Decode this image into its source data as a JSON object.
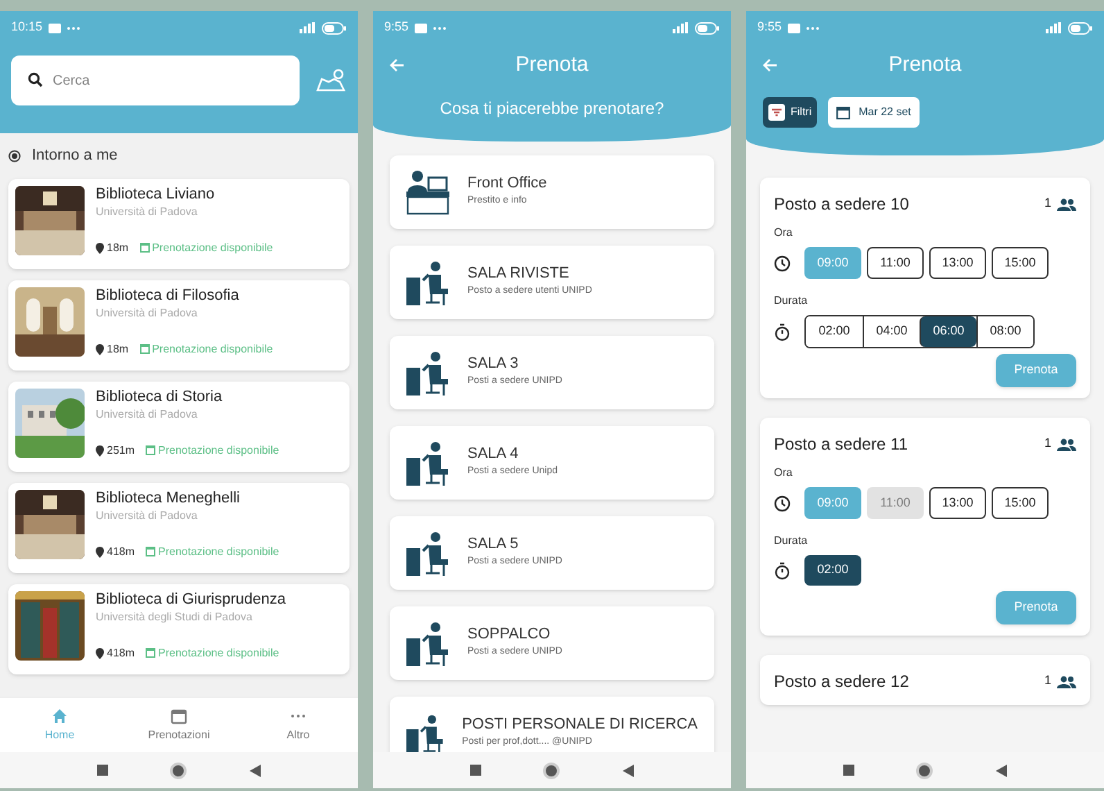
{
  "screens": [
    {
      "kind": "home",
      "status": {
        "time": "10:15"
      },
      "search": {
        "placeholder": "Cerca"
      },
      "section": "Intorno a me",
      "libraries": [
        {
          "name": "Biblioteca Liviano",
          "org": "Università di Padova",
          "distance": "18m",
          "availability": "Prenotazione disponibile"
        },
        {
          "name": "Biblioteca di Filosofia",
          "org": "Università di Padova",
          "distance": "18m",
          "availability": "Prenotazione disponibile"
        },
        {
          "name": "Biblioteca di Storia",
          "org": "Università di Padova",
          "distance": "251m",
          "availability": "Prenotazione disponibile"
        },
        {
          "name": "Biblioteca Meneghelli",
          "org": "Università di Padova",
          "distance": "418m",
          "availability": "Prenotazione disponibile"
        },
        {
          "name": "Biblioteca di Giurisprudenza",
          "org": "Università degli Studi di Padova",
          "distance": "418m",
          "availability": "Prenotazione disponibile"
        }
      ],
      "bottom_nav": [
        {
          "label": "Home",
          "selected": true,
          "kind": "home"
        },
        {
          "label": "Prenotazioni",
          "selected": false,
          "kind": "calendar"
        },
        {
          "label": "Altro",
          "selected": false,
          "kind": "more"
        }
      ]
    },
    {
      "kind": "rooms",
      "status": {
        "time": "9:55"
      },
      "title": "Prenota",
      "subtitle": "Cosa ti piacerebbe prenotare?",
      "rooms": [
        {
          "name": "Front Office",
          "description": "Prestito e info",
          "kind": "desk"
        },
        {
          "name": "SALA RIVISTE",
          "description": "Posto a sedere utenti UNIPD",
          "kind": "seat"
        },
        {
          "name": "SALA 3",
          "description": "Posti a sedere UNIPD",
          "kind": "seat"
        },
        {
          "name": "SALA 4",
          "description": "Posti a sedere Unipd",
          "kind": "seat"
        },
        {
          "name": "SALA 5",
          "description": "Posti a sedere UNIPD",
          "kind": "seat"
        },
        {
          "name": "SOPPALCO",
          "description": "Posti a sedere UNIPD",
          "kind": "seat"
        },
        {
          "name": "POSTI PERSONALE DI RICERCA",
          "description": "Posti per prof,dott.... @UNIPD",
          "kind": "seat"
        }
      ]
    },
    {
      "kind": "seats",
      "status": {
        "time": "9:55"
      },
      "title": "Prenota",
      "filter": "Filtri",
      "date": "Mar 22 set",
      "seats": [
        {
          "name": "Posto a sedere 10",
          "capacity": "1",
          "time_label": "Ora",
          "duration_label": "Durata",
          "button": "Prenota",
          "times": [
            {
              "label": "09:00",
              "selected": true,
              "disabled": false
            },
            {
              "label": "11:00",
              "selected": false,
              "disabled": false
            },
            {
              "label": "13:00",
              "selected": false,
              "disabled": false
            },
            {
              "label": "15:00",
              "selected": false,
              "disabled": false
            }
          ],
          "durations": [
            {
              "label": "02:00",
              "selected": false
            },
            {
              "label": "04:00",
              "selected": false
            },
            {
              "label": "06:00",
              "selected": true
            },
            {
              "label": "08:00",
              "selected": false
            }
          ]
        },
        {
          "name": "Posto a sedere 11",
          "capacity": "1",
          "time_label": "Ora",
          "duration_label": "Durata",
          "button": "Prenota",
          "times": [
            {
              "label": "09:00",
              "selected": true,
              "disabled": false
            },
            {
              "label": "11:00",
              "selected": false,
              "disabled": true
            },
            {
              "label": "13:00",
              "selected": false,
              "disabled": false
            },
            {
              "label": "15:00",
              "selected": false,
              "disabled": false
            }
          ],
          "durations": [
            {
              "label": "02:00",
              "selected": true
            }
          ]
        },
        {
          "name": "Posto a sedere 12",
          "capacity": "1"
        }
      ]
    }
  ]
}
